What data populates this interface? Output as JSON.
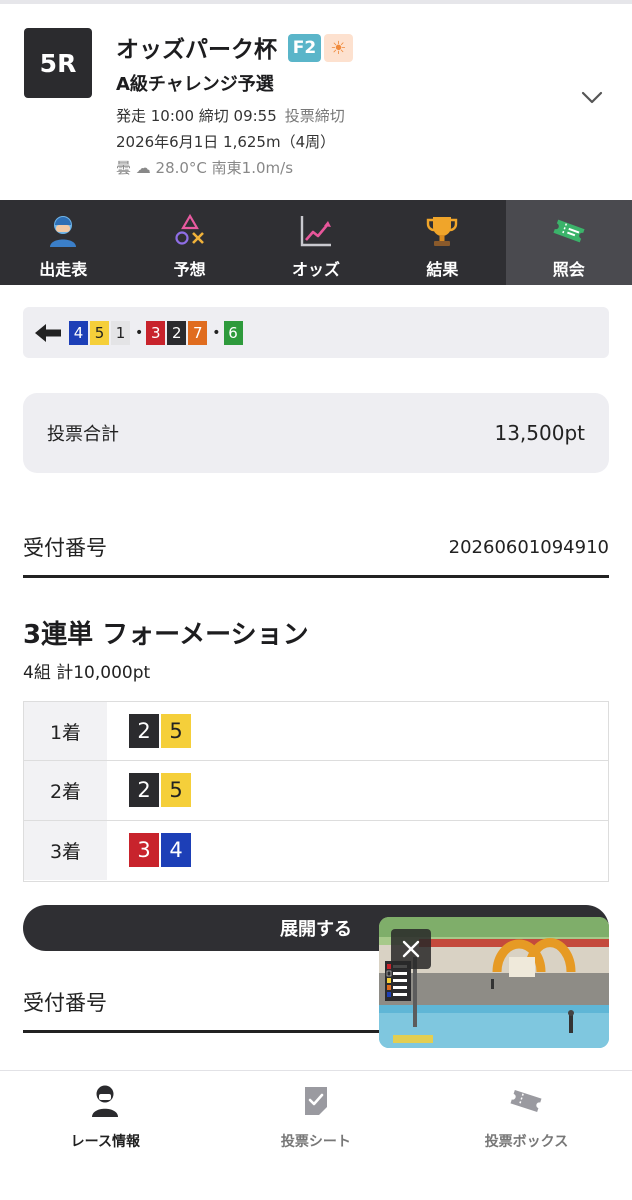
{
  "header": {
    "race_number": "5R",
    "race_name": "オッズパーク杯",
    "grade_badge": "F2",
    "sun_badge": "☀",
    "race_subtitle": "A級チャレンジ予選",
    "schedule": "発走 10:00 締切 09:55",
    "vote_status": "投票締切",
    "date_distance": "2026年6月1日 1,625m（4周）",
    "weather": "曇 ☁ 28.0°C 南東1.0m/s"
  },
  "tabs": [
    {
      "label": "出走表",
      "icon": "player-icon",
      "active": false
    },
    {
      "label": "予想",
      "icon": "prediction-icon",
      "active": false
    },
    {
      "label": "オッズ",
      "icon": "odds-chart-icon",
      "active": false
    },
    {
      "label": "結果",
      "icon": "trophy-icon",
      "active": false
    },
    {
      "label": "照会",
      "icon": "ticket-icon",
      "active": true
    }
  ],
  "line_formation": {
    "groups": [
      [
        {
          "n": "4",
          "bg": "#1d3fb7",
          "fg": "#ffffff"
        },
        {
          "n": "5",
          "bg": "#f5cf3a",
          "fg": "#222222"
        },
        {
          "n": "1",
          "bg": "#e4e4e6",
          "fg": "#222222"
        }
      ],
      [
        {
          "n": "3",
          "bg": "#c8232c",
          "fg": "#ffffff"
        },
        {
          "n": "2",
          "bg": "#2b2b2e",
          "fg": "#ffffff"
        },
        {
          "n": "7",
          "bg": "#e06c1f",
          "fg": "#ffffff"
        }
      ],
      [
        {
          "n": "6",
          "bg": "#2e9a3c",
          "fg": "#ffffff"
        }
      ]
    ]
  },
  "total": {
    "label": "投票合計",
    "value": "13,500pt"
  },
  "receipt": {
    "label": "受付番号",
    "number": "20260601094910"
  },
  "bet": {
    "title": "3連単 フォーメーション",
    "summary": "4組 計10,000pt",
    "rows": [
      {
        "label": "1着",
        "chips": [
          {
            "n": "2",
            "bg": "#2b2b2e",
            "fg": "#ffffff"
          },
          {
            "n": "5",
            "bg": "#f5cf3a",
            "fg": "#222222"
          }
        ]
      },
      {
        "label": "2着",
        "chips": [
          {
            "n": "2",
            "bg": "#2b2b2e",
            "fg": "#ffffff"
          },
          {
            "n": "5",
            "bg": "#f5cf3a",
            "fg": "#222222"
          }
        ]
      },
      {
        "label": "3着",
        "chips": [
          {
            "n": "3",
            "bg": "#c8232c",
            "fg": "#ffffff"
          },
          {
            "n": "4",
            "bg": "#1d3fb7",
            "fg": "#ffffff"
          }
        ]
      }
    ]
  },
  "expand_label": "展開する",
  "receipt2": {
    "label": "受付番号"
  },
  "video": {
    "close_icon": "close-icon"
  },
  "bottom_nav": [
    {
      "label": "レース情報",
      "icon": "race-info-icon",
      "active": true
    },
    {
      "label": "投票シート",
      "icon": "vote-sheet-icon",
      "active": false
    },
    {
      "label": "投票ボックス",
      "icon": "vote-box-icon",
      "active": false
    }
  ]
}
